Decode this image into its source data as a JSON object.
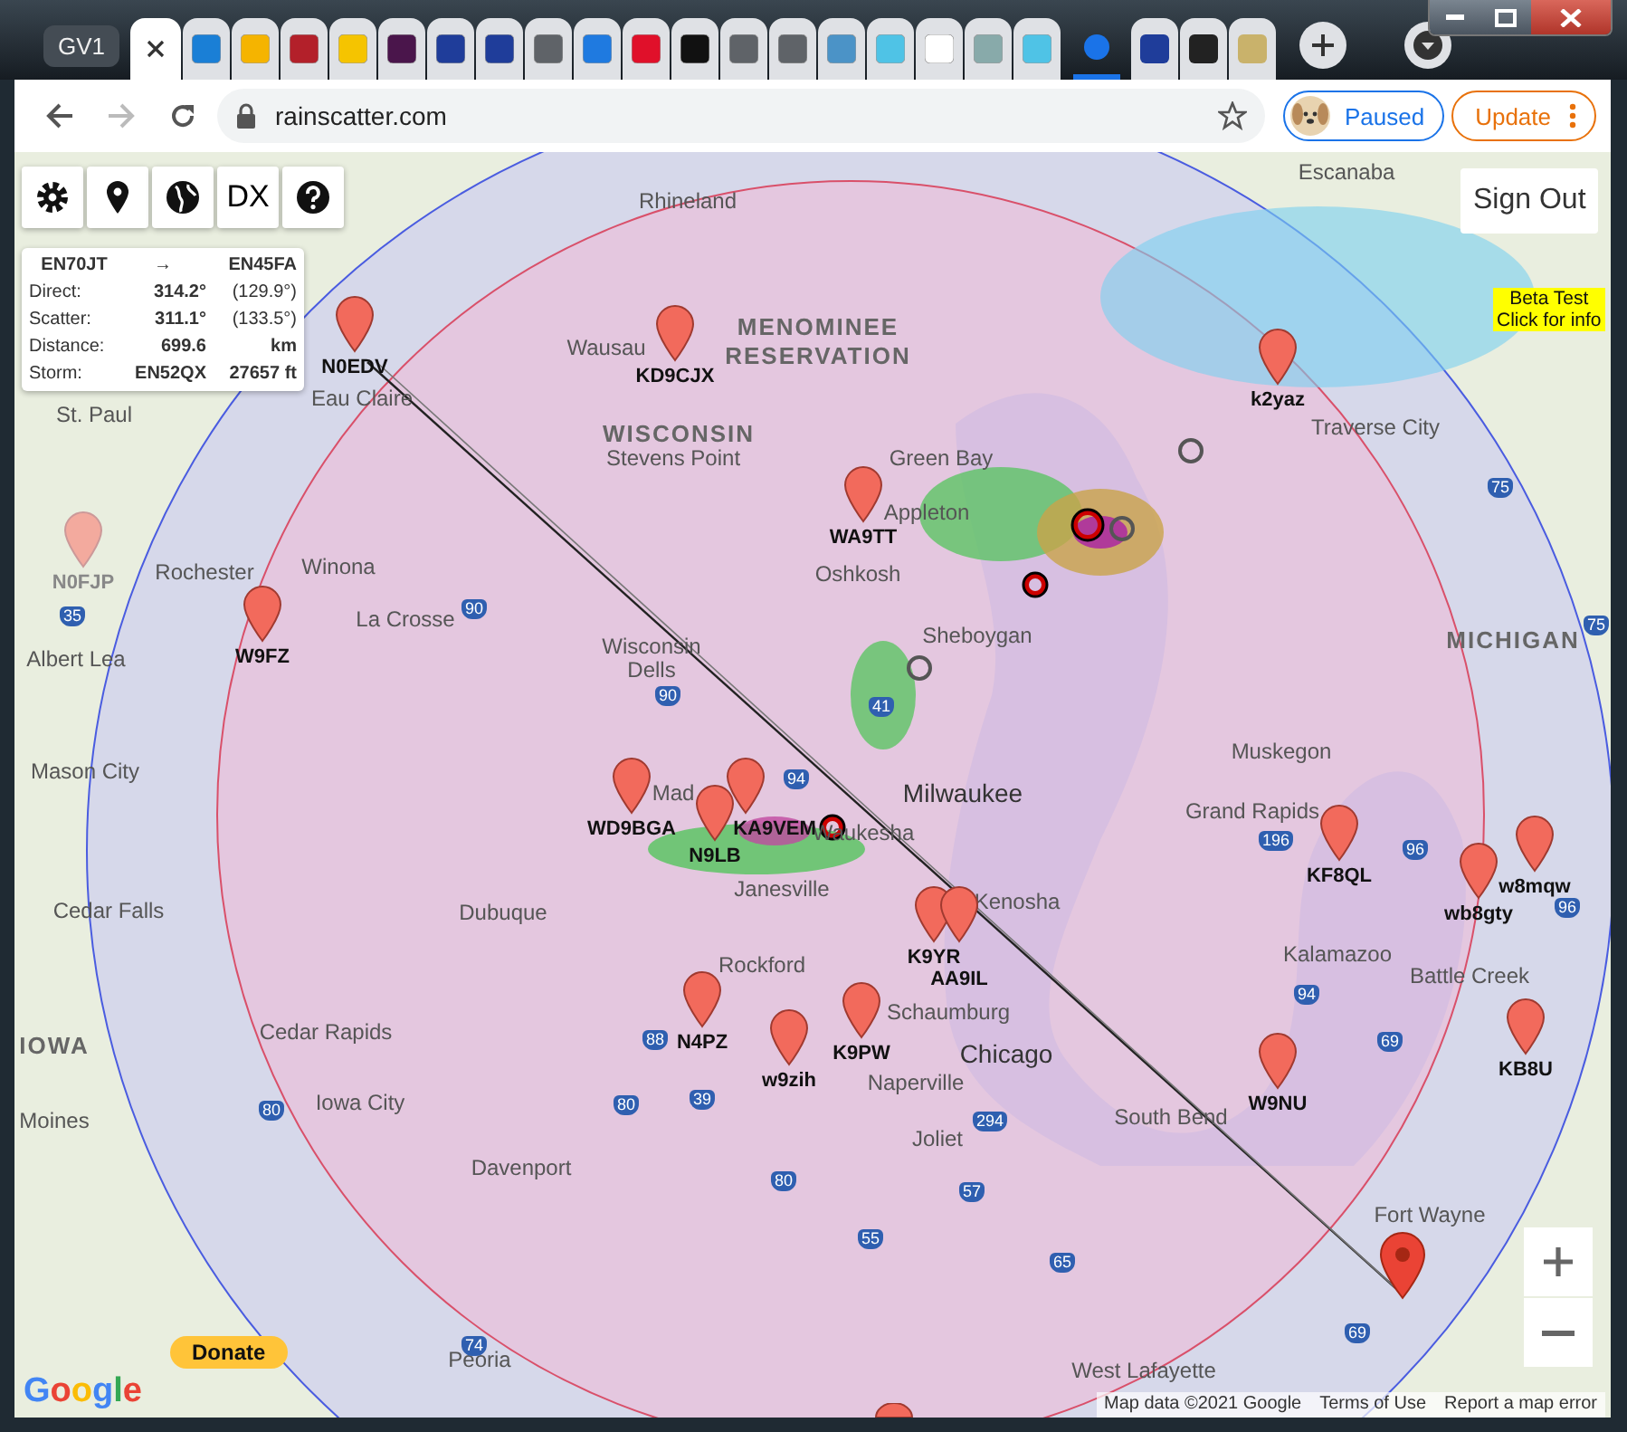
{
  "browser": {
    "tab_group": "GV1",
    "address": "rainscatter.com",
    "profile": "Paused",
    "update": "Update"
  },
  "map_toolbar": {
    "dx_label": "DX"
  },
  "route_panel": {
    "from": "EN70JT",
    "arrow": "→",
    "to": "EN45FA",
    "rows": [
      {
        "label": "Direct:",
        "value": "314.2°",
        "extra": "(129.9°)"
      },
      {
        "label": "Scatter:",
        "value": "311.1°",
        "extra": "(133.5°)"
      },
      {
        "label": "Distance:",
        "value": "699.6",
        "extra": "km"
      },
      {
        "label": "Storm:",
        "value": "EN52QX",
        "extra": "27657 ft"
      }
    ]
  },
  "sign_out": "Sign Out",
  "beta_notice": [
    "Beta Test",
    "Click for info"
  ],
  "places": [
    {
      "name": "Escanaba",
      "kind": "city"
    },
    {
      "name": "Rhineland",
      "kind": "city"
    },
    {
      "name": "MENOMINEE",
      "kind": "region"
    },
    {
      "name": "Wausau",
      "kind": "city"
    },
    {
      "name": "RESERVATION",
      "kind": "region"
    },
    {
      "name": "St. Paul",
      "kind": "city"
    },
    {
      "name": "Eau Claire",
      "kind": "city"
    },
    {
      "name": "Traverse City",
      "kind": "city"
    },
    {
      "name": "WISCONSIN",
      "kind": "region"
    },
    {
      "name": "Stevens Point",
      "kind": "city"
    },
    {
      "name": "Green Bay",
      "kind": "city"
    },
    {
      "name": "Appleton",
      "kind": "city"
    },
    {
      "name": "Rochester",
      "kind": "city"
    },
    {
      "name": "Winona",
      "kind": "city"
    },
    {
      "name": "Oshkosh",
      "kind": "city"
    },
    {
      "name": "La Crosse",
      "kind": "city"
    },
    {
      "name": "Albert Lea",
      "kind": "city"
    },
    {
      "name": "Wisconsin",
      "kind": "city"
    },
    {
      "name": "Sheboygan",
      "kind": "city"
    },
    {
      "name": "MICHIGAN",
      "kind": "region"
    },
    {
      "name": "Dells",
      "kind": "city"
    },
    {
      "name": "Muskegon",
      "kind": "city"
    },
    {
      "name": "Mason City",
      "kind": "city"
    },
    {
      "name": "Mad",
      "kind": "city"
    },
    {
      "name": "Milwaukee",
      "kind": "bigcity"
    },
    {
      "name": "Grand Rapids",
      "kind": "city"
    },
    {
      "name": "Waukesha",
      "kind": "city"
    },
    {
      "name": "Janesville",
      "kind": "city"
    },
    {
      "name": "Cedar Falls",
      "kind": "city"
    },
    {
      "name": "Dubuque",
      "kind": "city"
    },
    {
      "name": "Kenosha",
      "kind": "city"
    },
    {
      "name": "Rockford",
      "kind": "city"
    },
    {
      "name": "Kalamazoo",
      "kind": "city"
    },
    {
      "name": "Battle Creek",
      "kind": "city"
    },
    {
      "name": "Schaumburg",
      "kind": "city"
    },
    {
      "name": "Cedar Rapids",
      "kind": "city"
    },
    {
      "name": "IOWA",
      "kind": "region"
    },
    {
      "name": "Chicago",
      "kind": "bigcity"
    },
    {
      "name": "Naperville",
      "kind": "city"
    },
    {
      "name": "Moines",
      "kind": "city"
    },
    {
      "name": "Iowa City",
      "kind": "city"
    },
    {
      "name": "South Bend",
      "kind": "city"
    },
    {
      "name": "Joliet",
      "kind": "city"
    },
    {
      "name": "Davenport",
      "kind": "city"
    },
    {
      "name": "Fort Wayne",
      "kind": "city"
    },
    {
      "name": "Peoria",
      "kind": "city"
    },
    {
      "name": "West Lafayette",
      "kind": "city"
    }
  ],
  "highways": [
    "75",
    "35",
    "90",
    "75",
    "90",
    "41",
    "94",
    "196",
    "96",
    "96",
    "94",
    "88",
    "69",
    "80",
    "80",
    "39",
    "294",
    "80",
    "57",
    "55",
    "65",
    "74",
    "69"
  ],
  "stations": [
    {
      "callsign": "N0EDV",
      "dimmed": false
    },
    {
      "callsign": "KD9CJX",
      "dimmed": false
    },
    {
      "callsign": "k2yaz",
      "dimmed": false
    },
    {
      "callsign": "WA9TT",
      "dimmed": false
    },
    {
      "callsign": "N0FJP",
      "dimmed": true
    },
    {
      "callsign": "W9FZ",
      "dimmed": false
    },
    {
      "callsign": "WD9BGA",
      "dimmed": false
    },
    {
      "callsign": "KA9VEM",
      "dimmed": false
    },
    {
      "callsign": "N9LB",
      "dimmed": false
    },
    {
      "callsign": "KF8QL",
      "dimmed": false
    },
    {
      "callsign": "w8mqw",
      "dimmed": false
    },
    {
      "callsign": "wb8gty",
      "dimmed": false
    },
    {
      "callsign": "K9YR",
      "dimmed": false
    },
    {
      "callsign": "AA9IL",
      "dimmed": false
    },
    {
      "callsign": "N4PZ",
      "dimmed": false
    },
    {
      "callsign": "K9PW",
      "dimmed": false
    },
    {
      "callsign": "KB8U",
      "dimmed": false
    },
    {
      "callsign": "w9zih",
      "dimmed": false
    },
    {
      "callsign": "W9NU",
      "dimmed": false
    }
  ],
  "donate": "Donate",
  "logo": "Google",
  "attribution": [
    "Map data ©2021 Google",
    "Terms of Use",
    "Report a map error"
  ]
}
